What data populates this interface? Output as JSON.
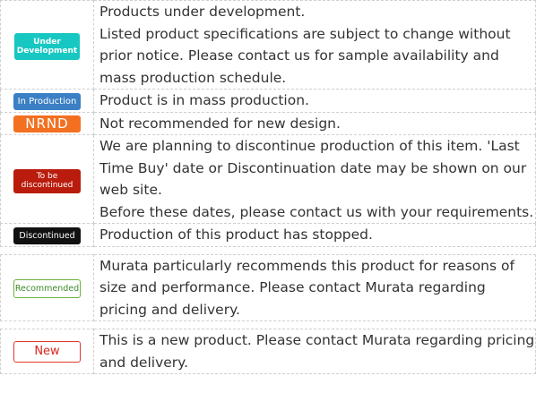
{
  "status_table": {
    "rows": [
      {
        "badge": [
          "Under",
          "Development"
        ],
        "badge_color": "#17c7c2",
        "lines": [
          "Products under development.",
          "Listed product specifications are subject to change without prior notice. Please contact us for sample availability and mass production schedule."
        ]
      },
      {
        "badge": [
          "In Production"
        ],
        "badge_color": "#3b7fc4",
        "lines": [
          "Product is in mass production."
        ]
      },
      {
        "badge": [
          "NRND"
        ],
        "badge_color": "#f37021",
        "lines": [
          "Not recommended for new design."
        ]
      },
      {
        "badge": [
          "To be",
          "discontinued"
        ],
        "badge_color": "#b91c0d",
        "lines": [
          "We are planning to discontinue production of this item. 'Last Time Buy' date or Discontinuation date may be shown on our web site.",
          "Before these dates, please contact us with your requirements."
        ]
      },
      {
        "badge": [
          "Discontinued"
        ],
        "badge_color": "#111111",
        "lines": [
          "Production of this product has stopped."
        ]
      }
    ]
  },
  "recommended": {
    "badge": "Recommended",
    "badge_color": "#6ab23c",
    "text": "Murata particularly recommends this product for reasons of size and performance. Please contact Murata regarding pricing and delivery."
  },
  "new_product": {
    "badge": "New",
    "badge_color": "#e03a2d",
    "text": "This is a new product. Please contact Murata regarding pricing and delivery."
  }
}
